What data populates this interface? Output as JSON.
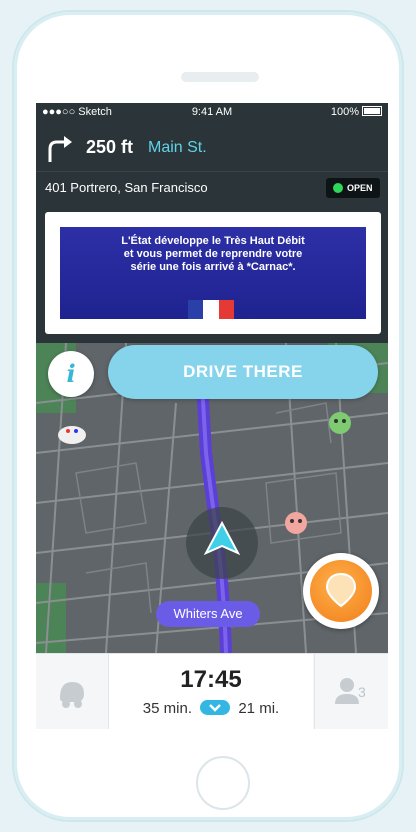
{
  "status_bar": {
    "carrier": "●●●○○ Sketch",
    "time": "9:41 AM",
    "battery": "100%"
  },
  "navigation": {
    "distance": "250 ft",
    "street": "Main St.",
    "turn_icon": "turn-right-arrow-icon"
  },
  "destination": {
    "address": "401 Portrero, San Francisco",
    "status": "OPEN"
  },
  "ad": {
    "line1": "L'État développe le Très Haut Débit",
    "line2": "et vous permet de reprendre votre",
    "line3": "série une fois arrivé à *Carnac*."
  },
  "actions": {
    "info_label": "i",
    "drive_label": "DRIVE THERE"
  },
  "map": {
    "street_label": "Whiters Ave"
  },
  "trip": {
    "eta": "17:45",
    "duration": "35 min.",
    "distance": "21 mi.",
    "users": "3"
  },
  "colors": {
    "route": "#5b3fd6",
    "accent": "#5fd4e8",
    "drive_button": "#85d4ec",
    "street_label": "#6b5ce7",
    "orange": "#f48a1f"
  }
}
